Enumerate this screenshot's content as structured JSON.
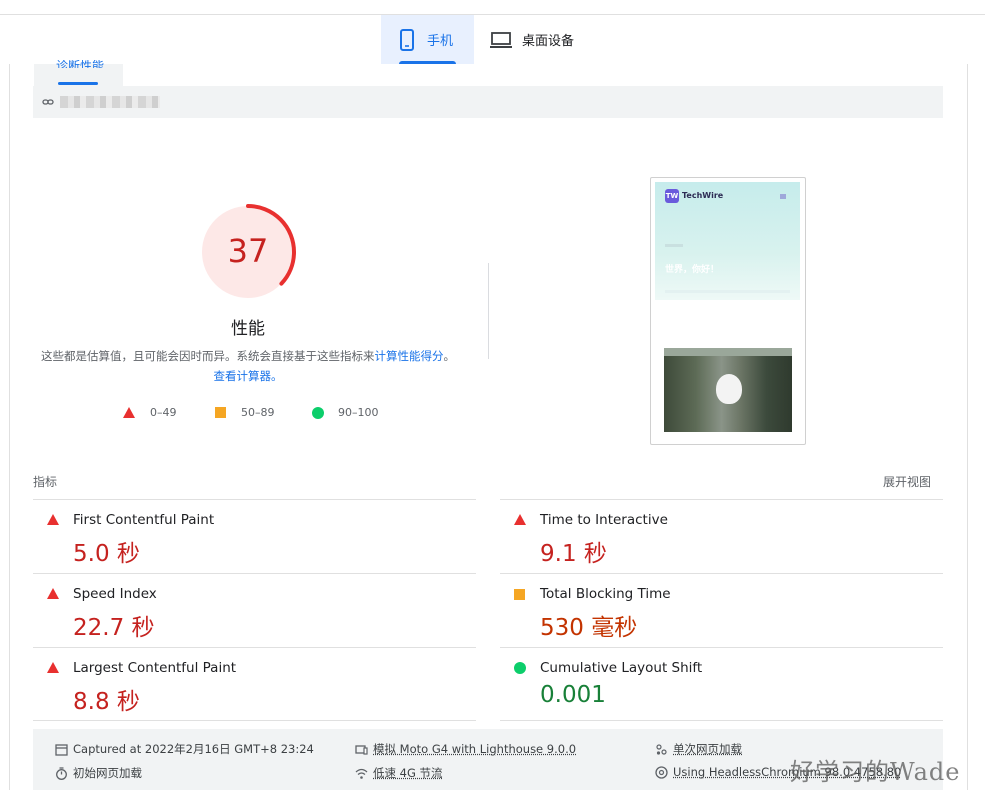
{
  "device_tabs": {
    "mobile_label": "手机",
    "desktop_label": "桌面设备"
  },
  "subtab": {
    "label": "诊断性能"
  },
  "score": {
    "value": 37,
    "value_text": "37",
    "title": "性能",
    "description_plain": "这些都是估算值，且可能会因时而异。系统会直接基于这些指标来",
    "description_link": "计算性能得分",
    "description_sep": "。",
    "calculator_link": "查看计算器。",
    "color": "#c5221f"
  },
  "legend": [
    {
      "shape": "triangle",
      "label": "0–49",
      "color": "#e8302f"
    },
    {
      "shape": "square",
      "label": "50–89",
      "color": "#f5a623"
    },
    {
      "shape": "circle",
      "label": "90–100",
      "color": "#0cce6b"
    }
  ],
  "thumbnail": {
    "brand": "TechWire",
    "logo_text": "TW",
    "hero_title": "世界，你好！"
  },
  "metrics_section": {
    "label": "指标",
    "expand_label": "展开视图"
  },
  "metrics": [
    {
      "name": "First Contentful Paint",
      "value": "5.0 秒",
      "status": "red"
    },
    {
      "name": "Time to Interactive",
      "value": "9.1 秒",
      "status": "red"
    },
    {
      "name": "Speed Index",
      "value": "22.7 秒",
      "status": "red"
    },
    {
      "name": "Total Blocking Time",
      "value": "530 毫秒",
      "status": "orange"
    },
    {
      "name": "Largest Contentful Paint",
      "value": "8.8 秒",
      "status": "red"
    },
    {
      "name": "Cumulative Layout Shift",
      "value": "0.001",
      "status": "green"
    }
  ],
  "footer": {
    "captured": "Captured at 2022年2月16日 GMT+8 23:24",
    "device": "模拟 Moto G4 with Lighthouse 9.0.0",
    "session": "单次网页加载",
    "initial_load": "初始网页加载",
    "throttling": "低速 4G 节流",
    "browser": "Using HeadlessChromium 98.0.4758.80"
  },
  "watermark": "好学习的Wade"
}
